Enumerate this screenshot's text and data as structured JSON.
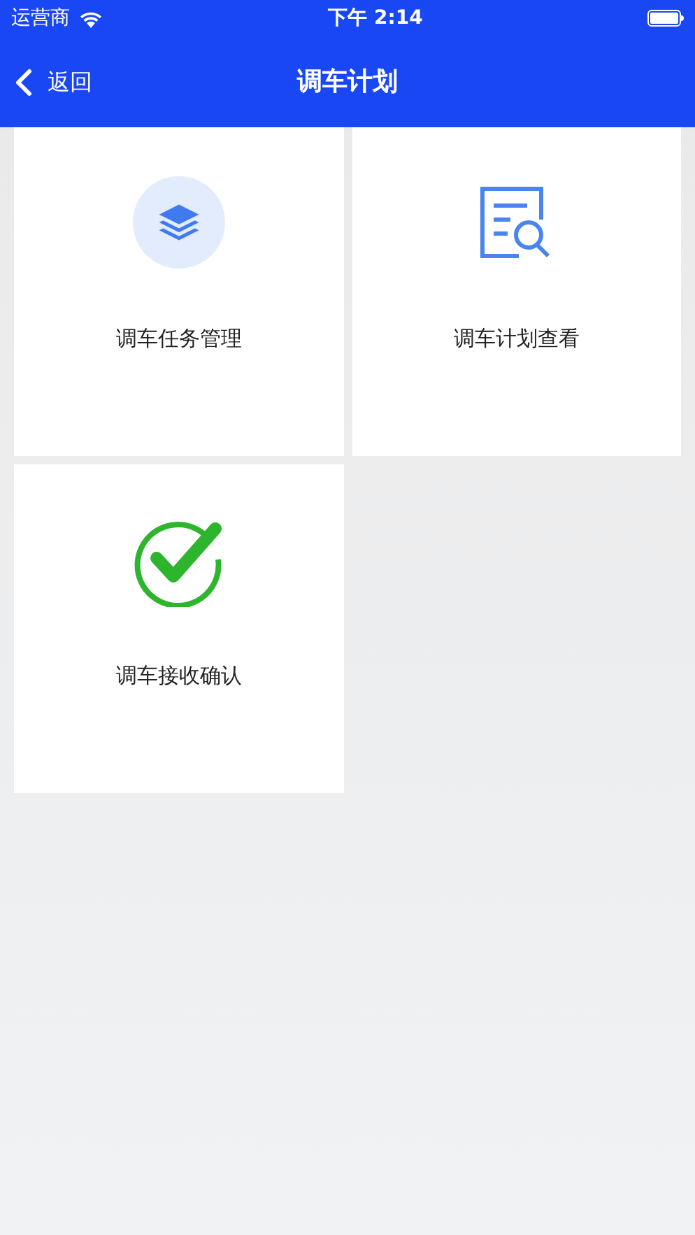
{
  "status_bar": {
    "carrier": "运营商",
    "time": "下午 2:14"
  },
  "nav_bar": {
    "back": "返回",
    "title": "调车计划"
  },
  "tiles": [
    {
      "kind": "layers",
      "label": "调车任务管理"
    },
    {
      "kind": "doc-search",
      "label": "调车计划查看"
    },
    {
      "kind": "check",
      "label": "调车接收确认"
    }
  ]
}
